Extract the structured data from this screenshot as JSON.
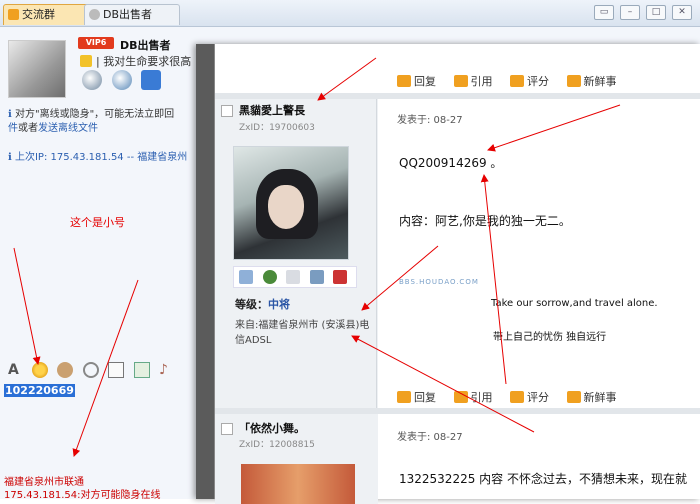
{
  "qq_window": {
    "tabs": [
      {
        "label": "交流群"
      },
      {
        "label": "DB出售者"
      }
    ],
    "window_controls": [
      "restore",
      "minimize",
      "maximize",
      "close"
    ],
    "contact": {
      "vip_badge": "VIP6",
      "name": "DB出售者",
      "status_text": "我对生命要求很高"
    },
    "notice": {
      "text_part1": "对方\"离线或隐身\"，可能无法立即回",
      "link1": "件",
      "text_part2": "或者",
      "link2": "发送离线文件"
    },
    "last_ip": "上次IP: 175.43.181.54 -- 福建省泉州",
    "annotation_small": "这个是小号",
    "qq_number": "102220669",
    "location_line1": "福建省泉州市联通",
    "location_line2": "175.43.181.54:对方可能隐身在线"
  },
  "forum": {
    "actions": {
      "reply": "回复",
      "quote": "引用",
      "rate": "评分",
      "news": "新鲜事"
    },
    "post1": {
      "username": "黑貓愛上警長",
      "zxid": "ZxID：19700603",
      "level_label": "等级：",
      "level_value": "中将",
      "from_text": "来自:福建省泉州市 (安溪县)电信ADSL",
      "posted": "发表于: 08-27",
      "qq_line": "QQ200914269 。",
      "content": "内容：阿艺,你是我的独一无二。",
      "watermark": "BBS.HOUDAO.COM",
      "sig_line1": "Take our sorrow,and travel alone.",
      "sig_line2": "带上自己的忧伤 独自远行"
    },
    "post2": {
      "username": "「依然小舞。",
      "zxid": "ZxID：12008815",
      "posted": "发表于: 08-27",
      "content": "1322532225 内容 不怀念过去，不猜想未来，现在就"
    }
  },
  "colors": {
    "annotation_red": "#e60000",
    "link_blue": "#2b5fb0",
    "level_blue": "#2a55a5",
    "action_icon_orange": "#f0a020"
  }
}
